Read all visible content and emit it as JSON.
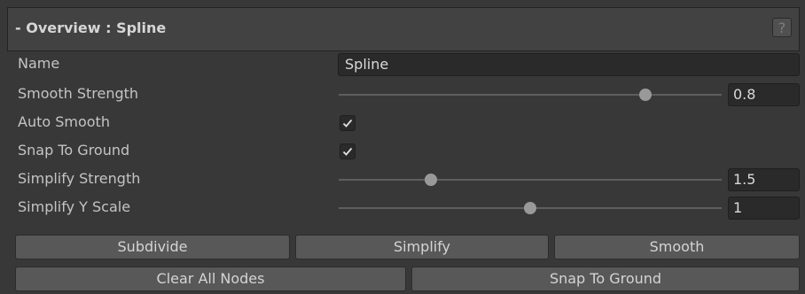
{
  "header": {
    "title": "- Overview : Spline",
    "help_icon": "?"
  },
  "fields": {
    "name": {
      "label": "Name",
      "value": "Spline"
    },
    "smooth_strength": {
      "label": "Smooth Strength",
      "value": "0.8",
      "fraction": 0.8
    },
    "auto_smooth": {
      "label": "Auto Smooth",
      "checked": true
    },
    "snap_to_ground": {
      "label": "Snap To Ground",
      "checked": true
    },
    "simplify_strength": {
      "label": "Simplify Strength",
      "value": "1.5",
      "fraction": 0.24
    },
    "simplify_y_scale": {
      "label": "Simplify Y Scale",
      "value": "1",
      "fraction": 0.5
    }
  },
  "buttons": {
    "subdivide": "Subdivide",
    "simplify": "Simplify",
    "smooth": "Smooth",
    "clear_all_nodes": "Clear All Nodes",
    "snap_to_ground": "Snap To Ground"
  }
}
